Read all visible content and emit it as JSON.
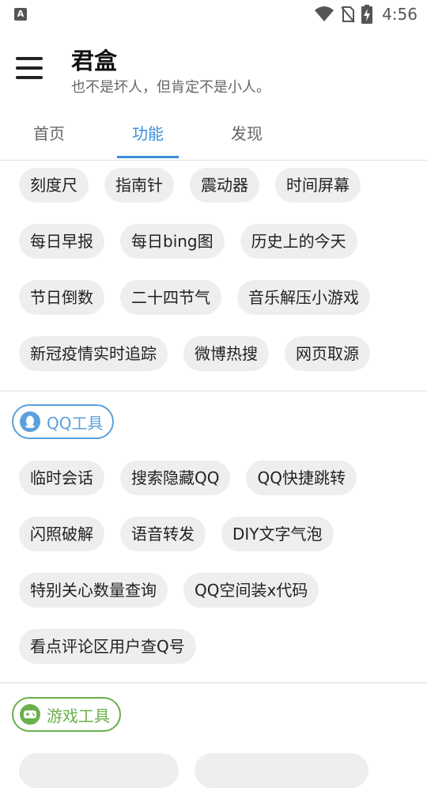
{
  "status_bar": {
    "time": "4:56"
  },
  "app": {
    "title": "君盒",
    "subtitle": "也不是坏人，但肯定不是小人。"
  },
  "tabs": [
    {
      "label": "首页",
      "active": false
    },
    {
      "label": "功能",
      "active": true
    },
    {
      "label": "发现",
      "active": false
    }
  ],
  "colors": {
    "accent": "#3b8fd9",
    "qq": "#5aa0dd",
    "game": "#6ab04c",
    "chip_bg": "#eeeeee"
  },
  "general_tools": [
    [
      "刻度尺",
      "指南针",
      "震动器",
      "时间屏幕"
    ],
    [
      "每日早报",
      "每日bing图",
      "历史上的今天"
    ],
    [
      "节日倒数",
      "二十四节气",
      "音乐解压小游戏"
    ],
    [
      "新冠疫情实时追踪",
      "微博热搜",
      "网页取源"
    ]
  ],
  "qq_section": {
    "label": "QQ工具",
    "icon": "qq-penguin-icon",
    "rows": [
      [
        "临时会话",
        "搜索隐藏QQ",
        "QQ快捷跳转"
      ],
      [
        "闪照破解",
        "语音转发",
        "DIY文字气泡"
      ],
      [
        "特别关心数量查询",
        "QQ空间装x代码"
      ],
      [
        "看点评论区用户查Q号"
      ]
    ]
  },
  "game_section": {
    "label": "游戏工具",
    "icon": "gamepad-icon"
  }
}
